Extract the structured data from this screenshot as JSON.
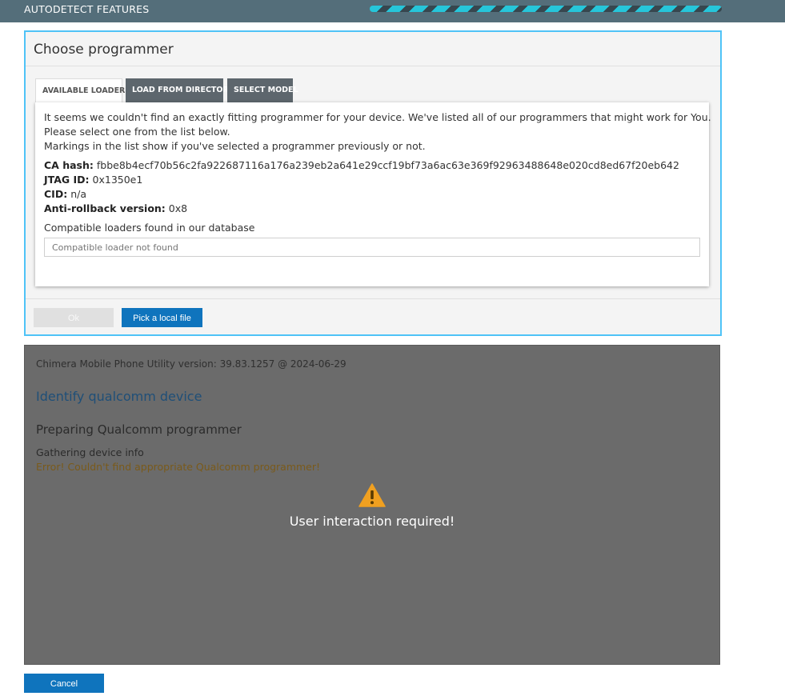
{
  "topbar": {
    "title": "AUTODETECT FEATURES",
    "progress_state": "indeterminate"
  },
  "dialog": {
    "title": "Choose programmer",
    "tabs": [
      {
        "label": "AVAILABLE LOADERS",
        "active": true
      },
      {
        "label": "LOAD FROM DIRECTORY",
        "active": false
      },
      {
        "label": "SELECT MODEL",
        "active": false
      }
    ],
    "message_lines": [
      "It seems we couldn't find an exactly fitting programmer for your device. We've listed all of our programmers that might work for You.",
      "Please select one from the list below.",
      "Markings in the list show if you've selected a programmer previously or not."
    ],
    "ca_hash_label": "CA hash:",
    "ca_hash": "fbbe8b4ecf70b56c2fa922687116a176a239eb2a641e29ccf19bf73a6ac63e369f92963488648e020cd8ed67f20eb642",
    "jtag_label": "JTAG ID:",
    "jtag_id": "0x1350e1",
    "cid_label": "CID:",
    "cid": "n/a",
    "antirollback_label": "Anti-rollback version:",
    "antirollback": "0x8",
    "compatible_label": "Compatible loaders found in our database",
    "loader_placeholder": "Compatible loader not found",
    "ok_label": "Ok",
    "pick_label": "Pick a local file"
  },
  "log": {
    "version": "Chimera Mobile Phone Utility version: 39.83.1257 @ 2024-06-29",
    "operation": "Identify qualcomm device",
    "step": "Preparing Qualcomm programmer",
    "gathering": "Gathering device info",
    "error": "Error! Couldn't find appropriate Qualcomm programmer!",
    "warning": "User interaction required!"
  },
  "cancel_label": "Cancel",
  "colors": {
    "accent": "#0f74bd",
    "dialog_border": "#4fc3f7",
    "topbar": "#546e7a",
    "log_bg": "#6b6b6b",
    "warning": "#f0a020"
  },
  "icons": {
    "warning": "warning-triangle-icon"
  }
}
